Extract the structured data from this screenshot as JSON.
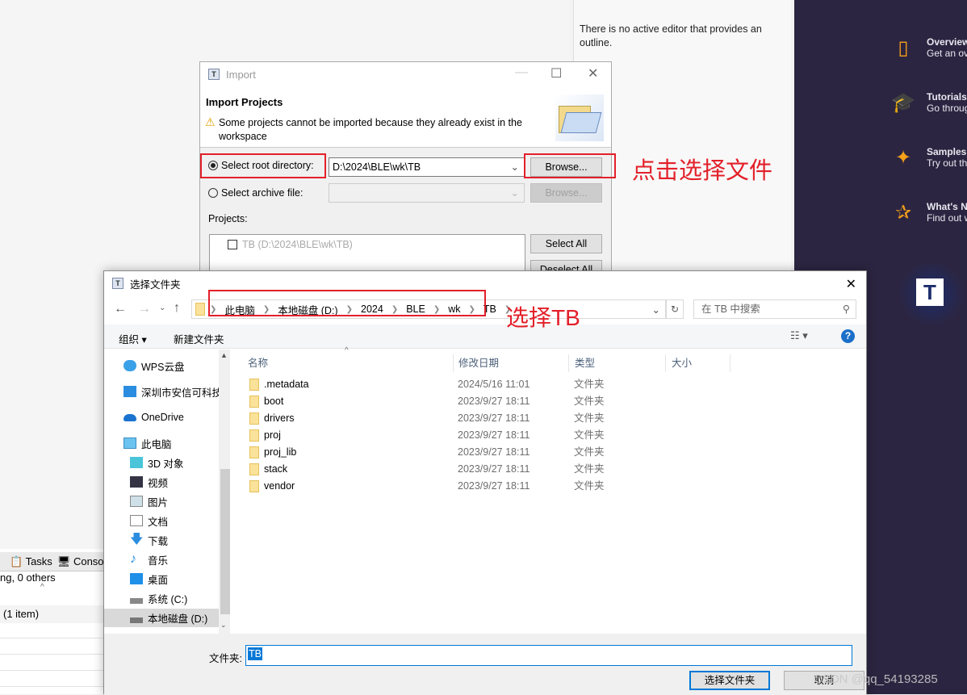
{
  "outline": {
    "message": "There is no active editor that provides an outline."
  },
  "welcome": {
    "items": [
      {
        "title": "Overview",
        "subtitle": "Get an ov",
        "icon": "map-icon"
      },
      {
        "title": "Tutorials",
        "subtitle": "Go throug",
        "icon": "graduation-cap-icon"
      },
      {
        "title": "Samples",
        "subtitle": "Try out th",
        "icon": "magic-wand-icon"
      },
      {
        "title": "What's N",
        "subtitle": "Find out w",
        "icon": "star-icon"
      }
    ],
    "logo": "T"
  },
  "bottom_panel": {
    "tabs": [
      "Tasks",
      "Conso"
    ],
    "summary": "ng, 0 others",
    "group_row": "(1 item)"
  },
  "import_dialog": {
    "title": "Import",
    "heading": "Import Projects",
    "warning": "Some projects cannot be imported because they already exist in the workspace",
    "root_dir_label": "Select root directory:",
    "root_dir_value": "D:\\2024\\BLE\\wk\\TB",
    "archive_label": "Select archive file:",
    "archive_value": "",
    "browse_label": "Browse...",
    "projects_label": "Projects:",
    "project_item": "TB (D:\\2024\\BLE\\wk\\TB)",
    "select_all": "Select All",
    "deselect_all": "Deselect All",
    "selected_option": "root_directory"
  },
  "folder_dialog": {
    "title": "选择文件夹",
    "breadcrumb": [
      "此电脑",
      "本地磁盘 (D:)",
      "2024",
      "BLE",
      "wk",
      "TB"
    ],
    "search_placeholder": "在 TB 中搜索",
    "organize": "组织 ▾",
    "new_folder": "新建文件夹",
    "nav": [
      {
        "label": "WPS云盘",
        "icon": "cloud-icon"
      },
      {
        "label": "深圳市安信可科技",
        "icon": "org-icon"
      },
      {
        "label": "OneDrive",
        "icon": "onedrive-icon"
      },
      {
        "label": "此电脑",
        "icon": "computer-icon"
      },
      {
        "label": "3D 对象",
        "icon": "cube-icon"
      },
      {
        "label": "视频",
        "icon": "video-icon"
      },
      {
        "label": "图片",
        "icon": "picture-icon"
      },
      {
        "label": "文档",
        "icon": "document-icon"
      },
      {
        "label": "下载",
        "icon": "download-icon"
      },
      {
        "label": "音乐",
        "icon": "music-icon"
      },
      {
        "label": "桌面",
        "icon": "desktop-icon"
      },
      {
        "label": "系统 (C:)",
        "icon": "drive-icon"
      },
      {
        "label": "本地磁盘 (D:)",
        "icon": "drive-icon"
      }
    ],
    "selected_nav": "本地磁盘 (D:)",
    "columns": [
      "名称",
      "修改日期",
      "类型",
      "大小"
    ],
    "files": [
      {
        "name": ".metadata",
        "date": "2024/5/16 11:01",
        "type": "文件夹"
      },
      {
        "name": "boot",
        "date": "2023/9/27 18:11",
        "type": "文件夹"
      },
      {
        "name": "drivers",
        "date": "2023/9/27 18:11",
        "type": "文件夹"
      },
      {
        "name": "proj",
        "date": "2023/9/27 18:11",
        "type": "文件夹"
      },
      {
        "name": "proj_lib",
        "date": "2023/9/27 18:11",
        "type": "文件夹"
      },
      {
        "name": "stack",
        "date": "2023/9/27 18:11",
        "type": "文件夹"
      },
      {
        "name": "vendor",
        "date": "2023/9/27 18:11",
        "type": "文件夹"
      }
    ],
    "folder_label": "文件夹:",
    "folder_value": "TB",
    "ok": "选择文件夹",
    "cancel": "取消"
  },
  "annotations": {
    "browse_hint": "点击选择文件",
    "select_hint": "选择TB",
    "color": "#e3202a"
  },
  "watermark": "CSDN @qq_54193285"
}
